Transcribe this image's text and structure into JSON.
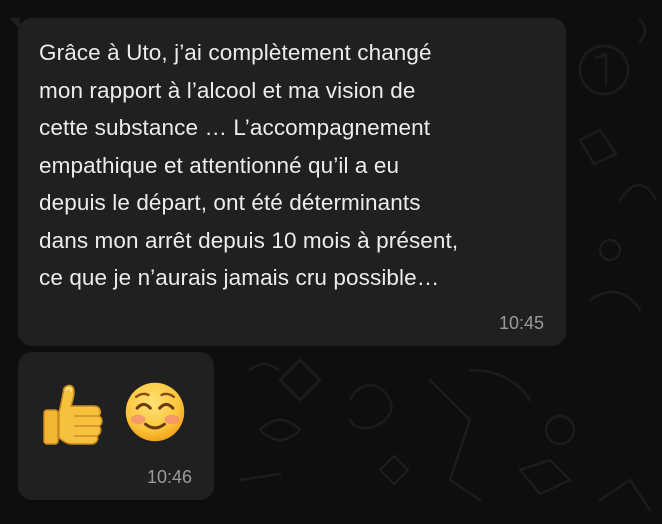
{
  "conversation": {
    "messages": [
      {
        "text": "Grâce à Uto, j’ai complètement changé\nmon rapport à l’alcool et ma vision de\ncette substance … L’accompagnement\nempathique et attentionné qu’il a eu\ndepuis le départ, ont été déterminants\ndans mon arrêt depuis 10 mois à présent,\nce que je n’aurais jamais cru possible…",
        "time": "10:45"
      },
      {
        "emojis": [
          "thumbs-up-icon",
          "smiling-face-icon"
        ],
        "time": "10:46"
      }
    ]
  },
  "colors": {
    "background": "#0e0e0e",
    "bubble": "#202020",
    "text": "#ececec",
    "timestamp": "#9a9a9a"
  }
}
